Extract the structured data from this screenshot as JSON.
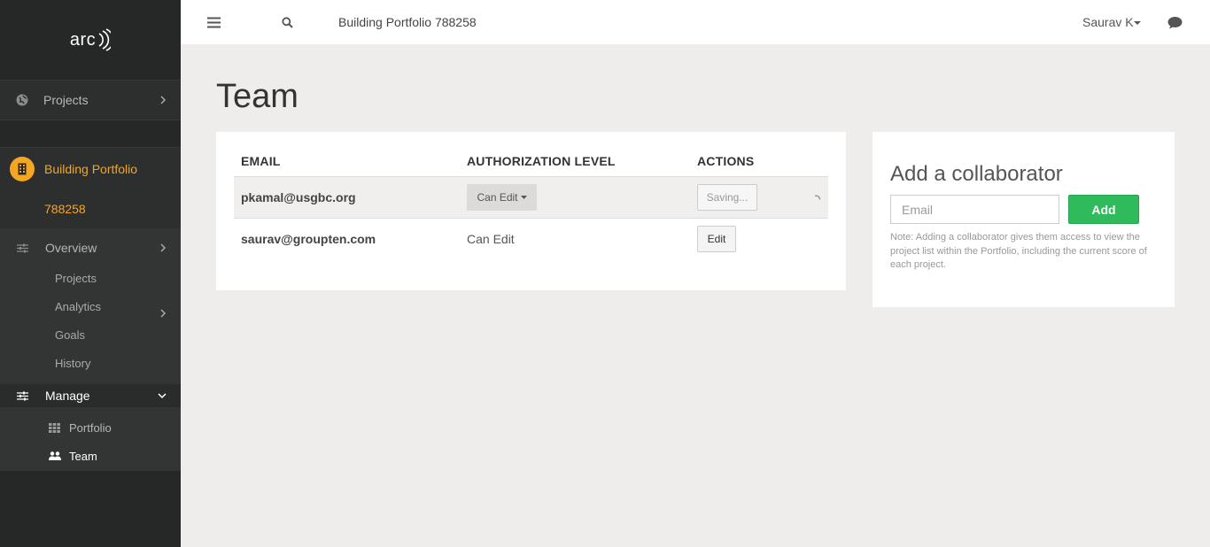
{
  "sidebar": {
    "logo": "arc",
    "projects": "Projects",
    "portfolio_title": "Building Portfolio",
    "portfolio_id": "788258",
    "overview": "Overview",
    "sub_items": [
      "Projects",
      "Analytics",
      "Goals",
      "History"
    ],
    "manage": "Manage",
    "manage_items": [
      "Portfolio",
      "Team"
    ]
  },
  "topbar": {
    "title": "Building Portfolio 788258",
    "user": "Saurav K"
  },
  "page": {
    "title": "Team"
  },
  "team_table": {
    "headers": [
      "EMAIL",
      "AUTHORIZATION LEVEL",
      "ACTIONS"
    ],
    "rows": [
      {
        "email": "pkamal@usgbc.org",
        "level": "Can Edit",
        "action": "Saving..."
      },
      {
        "email": "saurav@groupten.com",
        "level": "Can Edit",
        "action": "Edit"
      }
    ]
  },
  "collaborator": {
    "title": "Add a collaborator",
    "email_placeholder": "Email",
    "add_label": "Add",
    "note": "Note: Adding a collaborator gives them access to view the project list within the Portfolio, including the current score of each project."
  },
  "colors": {
    "accent": "#f5a623",
    "add": "#2fbb5b",
    "sidebar": "#262727"
  }
}
